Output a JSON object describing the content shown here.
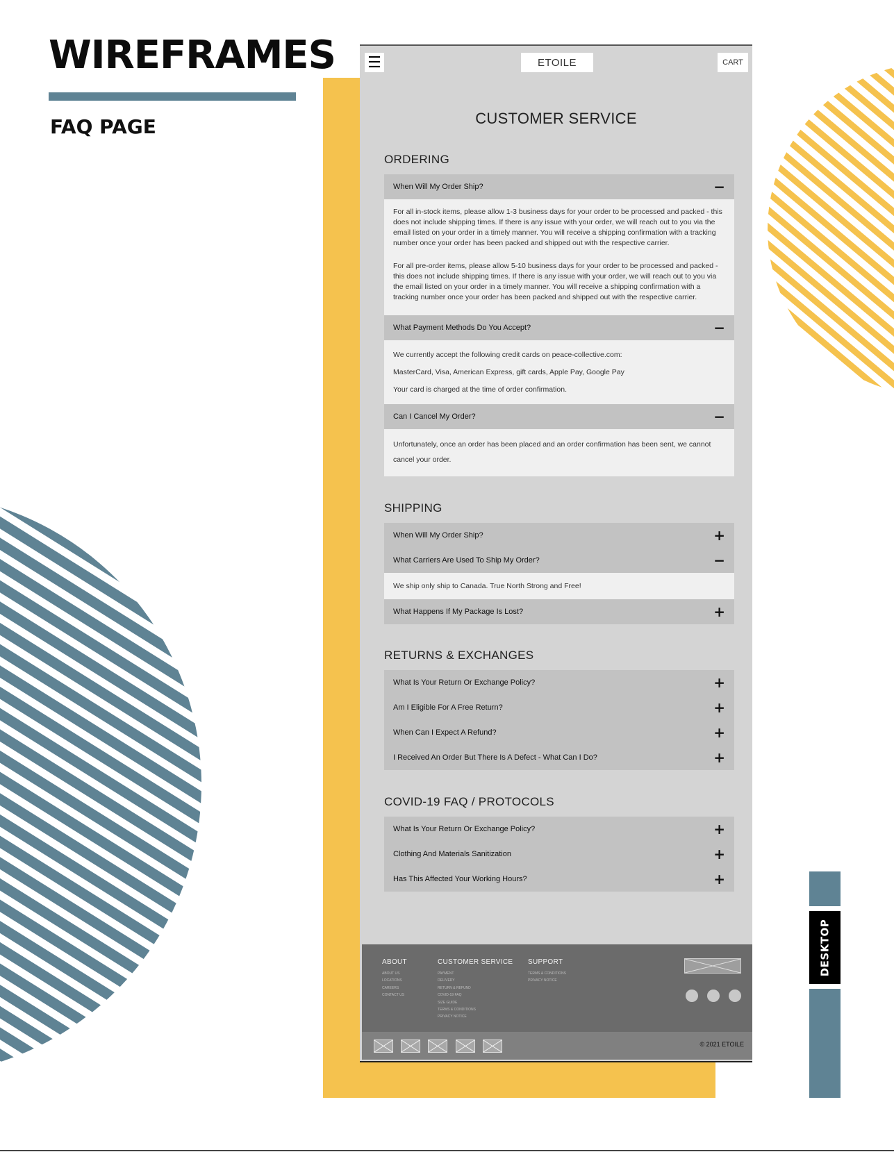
{
  "doc": {
    "title": "WIREFRAMES",
    "subtitle": "FAQ PAGE",
    "view_tab": "DESKTOP"
  },
  "colors": {
    "accent_blue": "#5f8394",
    "accent_yellow": "#f5c24e"
  },
  "header": {
    "menu_icon": "hamburger-menu-icon",
    "logo": "ETOILE",
    "cart": "CART"
  },
  "page_heading": "CUSTOMER SERVICE",
  "ordering": {
    "title": "ORDERING",
    "q1": "When Will My Order Ship?",
    "a1_p1": "For all in-stock items, please allow 1-3 business days for your order to be processed and packed - this does not include shipping times. If there is any issue with your order, we will reach out to you via the email listed on your order in a timely manner. You will receive a shipping confirmation with a tracking number once your order has been packed and shipped out with the respective carrier.",
    "a1_p2": "For all pre-order items, please allow 5-10 business days for your order to be processed and packed - this does not include shipping times. If there is any issue with your order, we will reach out to you via the email listed on your order in a timely manner. You will receive a shipping confirmation with a tracking number once your order has been packed and shipped out with the respective carrier.",
    "q2": "What Payment Methods Do You Accept?",
    "a2_l1": "We currently accept the following credit cards on peace-collective.com:",
    "a2_l2": "MasterCard, Visa, American Express, gift cards, Apple Pay, Google Pay",
    "a2_l3": "Your card is charged at the time of order confirmation.",
    "q3": "Can I Cancel My Order?",
    "a3": "Unfortunately, once an order has been placed and an order confirmation has been sent, we cannot cancel your order."
  },
  "shipping": {
    "title": "SHIPPING",
    "q1": "When Will My Order Ship?",
    "q2": "What Carriers Are Used To Ship My Order?",
    "a2": "We ship only ship to Canada. True North Strong and Free!",
    "q3": "What Happens If My Package Is Lost?"
  },
  "returns": {
    "title": "RETURNS & EXCHANGES",
    "q1": "What Is Your Return Or Exchange Policy?",
    "q2": "Am I Eligible For A Free Return?",
    "q3": "When Can I Expect A Refund?",
    "q4": "I Received An Order But There Is A Defect - What Can I Do?"
  },
  "covid": {
    "title": "COVID-19 FAQ / PROTOCOLS",
    "q1": "What Is Your Return Or Exchange Policy?",
    "q2": "Clothing And Materials Sanitization",
    "q3": "Has This Affected Your Working Hours?"
  },
  "icons": {
    "expanded": "−",
    "collapsed": "+"
  },
  "footer": {
    "about": {
      "title": "ABOUT",
      "links": [
        "ABOUT US",
        "LOCATIONS",
        "CAREERS",
        "CONTACT US"
      ]
    },
    "service": {
      "title": "CUSTOMER SERVICE",
      "links": [
        "PAYMENT",
        "DELIVERY",
        "RETURN & REFUND",
        "COVID-19 FAQ",
        "SIZE GUIDE",
        "TERMS & CONDITIONS",
        "PRIVACY NOTICE"
      ]
    },
    "support": {
      "title": "SUPPORT",
      "links": [
        "TERMS & CONDITIONS",
        "PRIVACY NOTICE"
      ]
    },
    "copyright": "© 2021 ETOILE"
  }
}
